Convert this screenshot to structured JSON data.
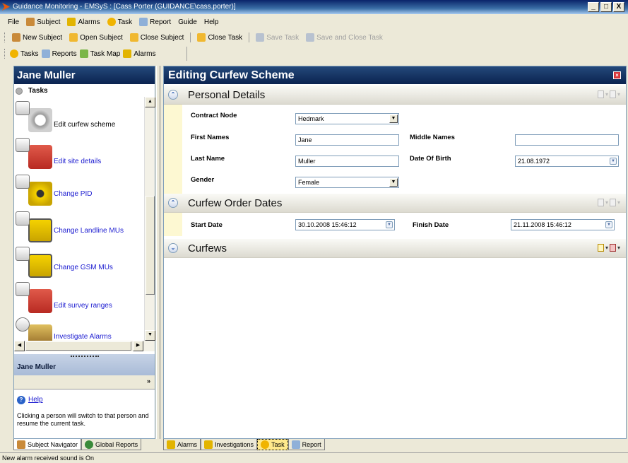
{
  "window": {
    "title": "Guidance Monitoring - EMSyS : [Cass Porter (GUIDANCE\\cass.porter)]",
    "minimize": "_",
    "maximize": "□",
    "close": "X"
  },
  "menu": [
    "File",
    "Subject",
    "Alarms",
    "Task",
    "Report",
    "Guide",
    "Help"
  ],
  "toolbar": {
    "new_subject": "New Subject",
    "open_subject": "Open Subject",
    "close_subject": "Close Subject",
    "close_task": "Close Task",
    "save_task": "Save Task",
    "save_close_task": "Save and Close Task"
  },
  "viewbar": {
    "tasks": "Tasks",
    "reports": "Reports",
    "task_map": "Task Map",
    "alarms": "Alarms"
  },
  "left_pane": {
    "title": "Jane Muller",
    "tasks_header": "Tasks",
    "tasks": [
      {
        "label": "Edit curfew scheme"
      },
      {
        "label": "Edit site details"
      },
      {
        "label": "Change PID"
      },
      {
        "label": "Change Landline MUs"
      },
      {
        "label": "Change GSM MUs"
      },
      {
        "label": "Edit survey ranges"
      },
      {
        "label": "Investigate Alarms"
      }
    ],
    "subject_header": "Jane Muller",
    "expand_glyph": "»",
    "help_link": "Help",
    "help_text": "Clicking a person will switch to that person and resume the current task."
  },
  "left_tabs": [
    "Subject Navigator",
    "Global Reports"
  ],
  "right_tabs": [
    "Alarms",
    "Investigations",
    "Task",
    "Report"
  ],
  "status": "New alarm received sound is On",
  "editor": {
    "title": "Editing Curfew Scheme",
    "sections": {
      "personal": "Personal Details",
      "curfew_dates": "Curfew Order Dates",
      "curfews": "Curfews"
    },
    "fields": {
      "contract_node_label": "Contract Node",
      "contract_node_value": "Hedmark",
      "first_names_label": "First Names",
      "first_names_value": "Jane",
      "middle_names_label": "Middle Names",
      "middle_names_value": "",
      "last_name_label": "Last Name",
      "last_name_value": "Muller",
      "dob_label": "Date Of Birth",
      "dob_value": "21.08.1972",
      "gender_label": "Gender",
      "gender_value": "Female",
      "start_date_label": "Start Date",
      "start_date_value": "30.10.2008 15:46:12",
      "finish_date_label": "Finish Date",
      "finish_date_value": "21.11.2008 15:46:12"
    }
  },
  "colors": {
    "header_dark": "#0b2350",
    "link": "#1a1ad0",
    "stripe": "#fdf8d2"
  }
}
